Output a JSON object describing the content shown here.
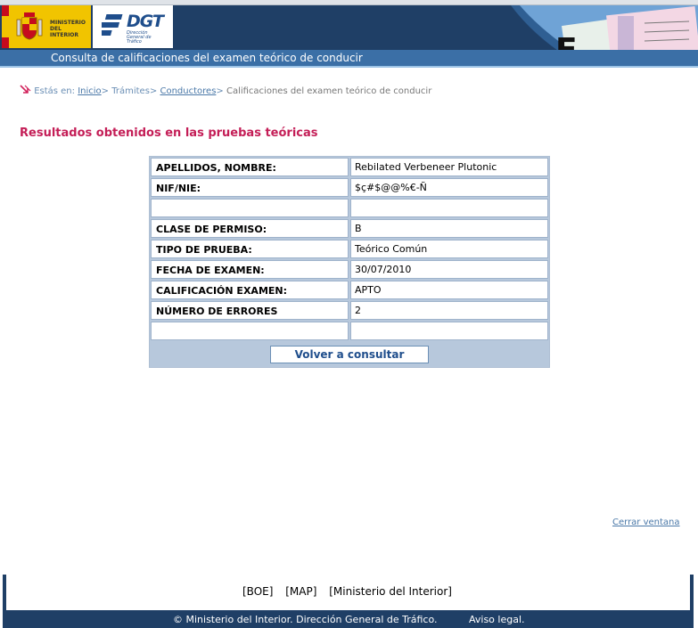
{
  "header": {
    "ministry_logo_text": "MINISTERIO DEL INTERIOR",
    "dgt_logo_text": "DGT",
    "dgt_logo_subtext": "Dirección General de Tráfico",
    "subtitle": "Consulta de calificaciones del examen teórico de conducir",
    "colors": {
      "navy": "#1f3f66",
      "bar": "#3b6fa6",
      "accent": "#c41e57"
    }
  },
  "breadcrumb": {
    "prefix": "Estás en:",
    "items": [
      {
        "label": "Inicio",
        "link": true
      },
      {
        "label": "Trámites",
        "link": false
      },
      {
        "label": "Conductores",
        "link": true
      },
      {
        "label": "Calificaciones del examen teórico de conducir",
        "link": false
      }
    ]
  },
  "main": {
    "heading": "Resultados obtenidos en las pruebas teóricas",
    "rows": [
      {
        "label": "APELLIDOS, NOMBRE:",
        "value": "Rebilated Verbeneer Plutonic"
      },
      {
        "label": "NIF/NIE:",
        "value": "$ç#$@@%€-Ñ"
      },
      {
        "label": "",
        "value": ""
      },
      {
        "label": "CLASE DE PERMISO:",
        "value": "B"
      },
      {
        "label": "TIPO DE PRUEBA:",
        "value": "Teórico Común"
      },
      {
        "label": "FECHA DE EXAMEN:",
        "value": "30/07/2010"
      },
      {
        "label": "CALIFICACIÓN EXAMEN:",
        "value": "APTO"
      },
      {
        "label": "NÚMERO DE ERRORES",
        "value": "2"
      },
      {
        "label": "",
        "value": ""
      }
    ],
    "button_label": "Volver a consultar"
  },
  "close_link": "Cerrar ventana",
  "footer": {
    "links": [
      "[BOE]",
      "[MAP]",
      "[Ministerio del Interior]"
    ],
    "copyright": "© Ministerio del Interior. Dirección General de Tráfico.",
    "legal": "Aviso legal."
  }
}
